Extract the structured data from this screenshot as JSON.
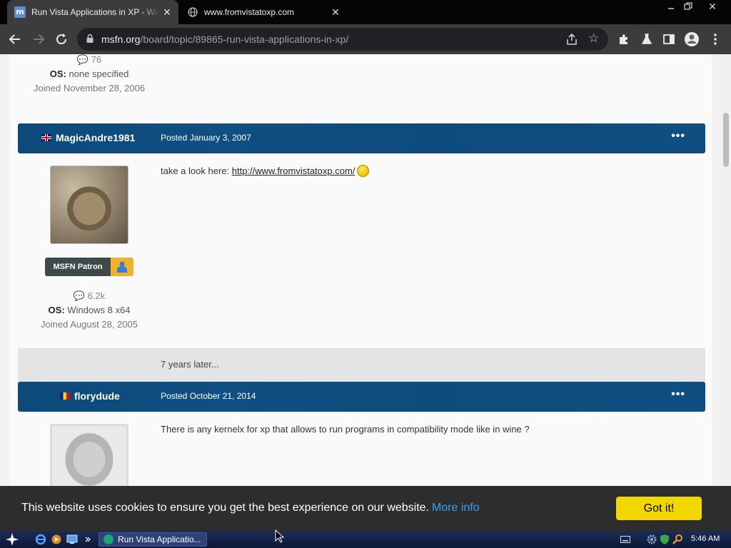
{
  "browser": {
    "tabs": [
      {
        "title": "Run Vista Applications in XP - Windo",
        "active": true,
        "favicon": "msfn-favicon-icon"
      },
      {
        "title": "www.fromvistatoxp.com",
        "active": false,
        "favicon": "globe-icon"
      }
    ],
    "url": {
      "host": "msfn.org",
      "path": "/board/topic/89865-run-vista-applications-in-xp/"
    }
  },
  "page": {
    "prev_author": {
      "comments": "76",
      "os_label": "OS:",
      "os": "none specified",
      "joined": "Joined November 28, 2006"
    },
    "posts": [
      {
        "author": "MagicAndre1981",
        "flag": "uk-flag-icon",
        "posted": "Posted January 3, 2007",
        "menu": "•••",
        "body_prefix": "take a look here: ",
        "body_link": "http://www.fromvistatoxp.com/",
        "badge": "MSFN Patron",
        "comments": "6.2k",
        "os_label": "OS:",
        "os": "Windows 8 x64",
        "joined": "Joined August 28, 2005"
      },
      {
        "author": "florydude",
        "flag": "romania-flag-icon",
        "posted": "Posted October 21, 2014",
        "menu": "•••",
        "body": "There is any kernelx for xp that allows to run programs in compatibility mode like in wine ?"
      }
    ],
    "gap_text": "7 years later..."
  },
  "cookie": {
    "message": "This website uses cookies to ensure you get the best experience on our website.",
    "more_info": "More info",
    "button": "Got it!"
  },
  "taskbar": {
    "task_title": "Run Vista Applicatio...",
    "clock": "5:46 AM"
  },
  "colors": {
    "post_header": "#0f4e80",
    "cookie_bg": "#2d2d2d",
    "cookie_button": "#f1d600",
    "link_blue": "#38a0f0"
  }
}
